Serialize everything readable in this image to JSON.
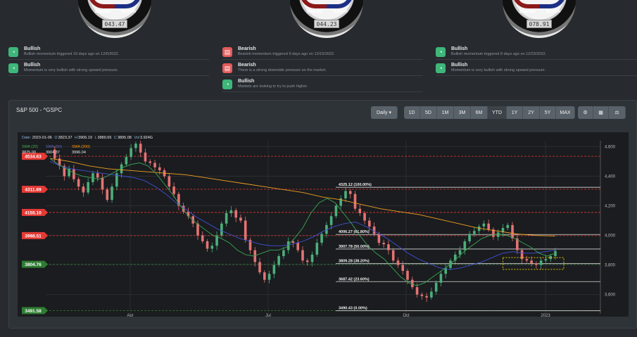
{
  "gauges": [
    {
      "bearish_label": "Bearish",
      "bullish_label": "Bullish",
      "value": "043.47"
    },
    {
      "bearish_label": "Bearish",
      "bullish_label": "Bullish",
      "value": "044.23"
    },
    {
      "bearish_label": "Bearish",
      "bullish_label": "Bullish",
      "value": "078.91"
    }
  ],
  "signals": [
    [
      {
        "kind": "bull",
        "title": "Bullish",
        "desc": "Bullish momentum triggered 19 days ago on 12/5/2022."
      },
      {
        "kind": "bull",
        "title": "Bullish",
        "desc": "Momentum is very bullish with strong upward pressure."
      }
    ],
    [
      {
        "kind": "bear",
        "title": "Bearish",
        "desc": "Bearish momentum triggered 9 days ago on 12/15/2022."
      },
      {
        "kind": "bear",
        "title": "Bearish",
        "desc": "There is a strong downside pressure on the market."
      },
      {
        "kind": "bull",
        "title": "Bullish",
        "desc": "Markets are looking to try to push higher."
      }
    ],
    [
      {
        "kind": "bull",
        "title": "Bullish",
        "desc": "Bullish momentum triggered 8 days ago on 12/23/2022."
      },
      {
        "kind": "bull",
        "title": "Bullish",
        "desc": "Momentum is very bullish with strong upward pressure."
      }
    ]
  ],
  "chart_header": {
    "title": "S&P 500 - ^GSPC",
    "interval": "Daily",
    "ranges": [
      "1D",
      "5D",
      "1M",
      "3M",
      "6M",
      "YTD",
      "1Y",
      "2Y",
      "5Y",
      "MAX"
    ],
    "active_range": "YTD",
    "tool_icons": [
      "settings-icon",
      "calculator-icon",
      "balance-scale-icon"
    ]
  },
  "ohlc": {
    "date_label": "Date",
    "date": "2023-01-06",
    "o_label": "O",
    "o": "3823.37",
    "h_label": "H",
    "h": "3906.19",
    "l_label": "L",
    "l": "3889.56",
    "c_label": "C",
    "c": "3895.08",
    "vol_label": "Vol",
    "vol": "3.924G"
  },
  "sma_legend": [
    {
      "name": "SMA (20)",
      "value": "3875.00",
      "color": "#4caf50"
    },
    {
      "name": "SMA (50)",
      "value": "3904.37",
      "color": "#3f51b5"
    },
    {
      "name": "SMA (200)",
      "value": "3996.04",
      "color": "#ff9800"
    }
  ],
  "chart_data": {
    "type": "candlestick",
    "x_ticks": [
      "Apr",
      "Jul",
      "Oct",
      "2023"
    ],
    "y_ticks": [
      3600,
      3800,
      4000,
      4200,
      4400,
      4600
    ],
    "y_tick_labels": [
      "3,600",
      "3,800",
      "4,000",
      "4,200",
      "4,400",
      "4,600"
    ],
    "ylim": [
      3470,
      4640
    ],
    "support_resistance": [
      {
        "value": 4534.63,
        "label": "4534.63",
        "color": "#e53935"
      },
      {
        "value": 4311.69,
        "label": "4311.69",
        "color": "#e53935"
      },
      {
        "value": 4155.1,
        "label": "4155.10",
        "color": "#e53935"
      },
      {
        "value": 3998.51,
        "label": "3998.51",
        "color": "#e53935"
      },
      {
        "value": 3804.76,
        "label": "3804.76",
        "color": "#2e7d32"
      },
      {
        "value": 3491.58,
        "label": "3491.58",
        "color": "#2e7d32"
      }
    ],
    "fibonacci": [
      {
        "value": 4325.12,
        "label": "4325.12 (100.00%)"
      },
      {
        "value": 4006.27,
        "label": "4006.27 (61.80%)"
      },
      {
        "value": 3907.78,
        "label": "3907.78 (50.00%)"
      },
      {
        "value": 3809.28,
        "label": "3809.28 (38.20%)"
      },
      {
        "value": 3687.42,
        "label": "3687.42 (23.60%)"
      },
      {
        "value": 3490.43,
        "label": "3490.43 (0.00%)"
      }
    ],
    "close_path": [
      4580,
      4520,
      4470,
      4400,
      4450,
      4380,
      4330,
      4290,
      4360,
      4420,
      4390,
      4310,
      4240,
      4330,
      4420,
      4480,
      4530,
      4590,
      4620,
      4560,
      4500,
      4490,
      4460,
      4440,
      4400,
      4330,
      4280,
      4200,
      4160,
      4130,
      4080,
      4000,
      3960,
      3910,
      3930,
      4000,
      4080,
      4150,
      4170,
      4120,
      4100,
      3970,
      3900,
      3820,
      3750,
      3700,
      3740,
      3800,
      3860,
      3900,
      3960,
      3950,
      3900,
      3830,
      3820,
      3870,
      3950,
      4010,
      4070,
      4130,
      4200,
      4250,
      4300,
      4280,
      4180,
      4150,
      4100,
      4060,
      4010,
      3950,
      3940,
      3900,
      3830,
      3800,
      3760,
      3700,
      3650,
      3600,
      3590,
      3580,
      3620,
      3680,
      3740,
      3780,
      3830,
      3870,
      3900,
      3960,
      4010,
      4030,
      4060,
      4080,
      4040,
      3990,
      4020,
      4050,
      4070,
      3980,
      3900,
      3840,
      3830,
      3810,
      3800,
      3830,
      3840,
      3860,
      3895
    ],
    "sma20": [
      4520,
      4480,
      4450,
      4420,
      4400,
      4390,
      4380,
      4400,
      4430,
      4460,
      4480,
      4490,
      4470,
      4420,
      4350,
      4280,
      4200,
      4130,
      4080,
      4040,
      4000,
      3980,
      3950,
      3900,
      3870,
      3860,
      3880,
      3900,
      3900,
      3920,
      3980,
      4050,
      4150,
      4220,
      4250,
      4220,
      4150,
      4080,
      4000,
      3930,
      3880,
      3840,
      3780,
      3720,
      3680,
      3660,
      3680,
      3720,
      3760,
      3800,
      3850,
      3900,
      3940,
      3980,
      4000,
      4010,
      4000,
      3980,
      3950,
      3920,
      3880,
      3860,
      3880
    ],
    "sma50": [
      4500,
      4470,
      4450,
      4440,
      4430,
      4420,
      4410,
      4400,
      4390,
      4370,
      4330,
      4280,
      4220,
      4170,
      4120,
      4080,
      4040,
      4010,
      3980,
      3960,
      3940,
      3930,
      3930,
      3940,
      3960,
      3990,
      4030,
      4060,
      4080,
      4090,
      4060,
      4020,
      3980,
      3930,
      3880,
      3840,
      3810,
      3780,
      3770,
      3780,
      3800,
      3820,
      3850,
      3880,
      3890,
      3880,
      3880,
      3890,
      3900
    ],
    "sma200": [
      4520,
      4500,
      4470,
      4450,
      4440,
      4430,
      4420,
      4410,
      4390,
      4370,
      4350,
      4330,
      4310,
      4290,
      4260,
      4240,
      4210,
      4180,
      4160,
      4140,
      4110,
      4080,
      4050,
      4030,
      4010,
      4000,
      3996
    ],
    "box_range": [
      3770,
      3850
    ]
  }
}
